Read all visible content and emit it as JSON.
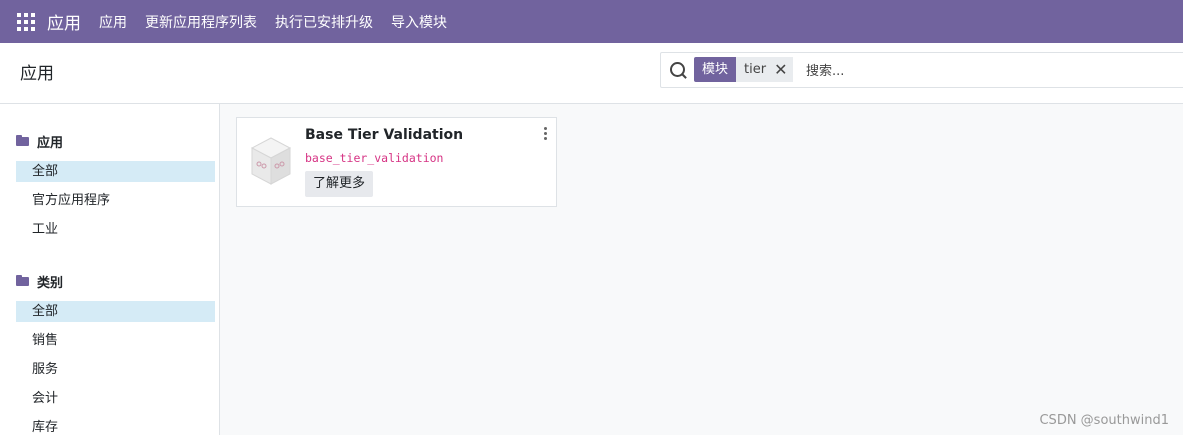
{
  "topbar": {
    "brand": "应用",
    "menu": [
      "应用",
      "更新应用程序列表",
      "执行已安排升级",
      "导入模块"
    ],
    "color": "#71639e"
  },
  "control_panel": {
    "breadcrumb": "应用",
    "search": {
      "facet_label": "模块",
      "facet_value": "tier",
      "placeholder": "搜索..."
    }
  },
  "sidebar": {
    "sections": [
      {
        "title": "应用",
        "items": [
          "全部",
          "官方应用程序",
          "工业"
        ],
        "active": 0
      },
      {
        "title": "类别",
        "items": [
          "全部",
          "销售",
          "服务",
          "会计",
          "库存"
        ],
        "active": 0
      }
    ],
    "active_color": "#d5ebf6"
  },
  "module_card": {
    "name": "Base Tier Validation",
    "technical_name": "base_tier_validation",
    "learn_more_label": "了解更多"
  },
  "watermark": "CSDN @southwind1"
}
